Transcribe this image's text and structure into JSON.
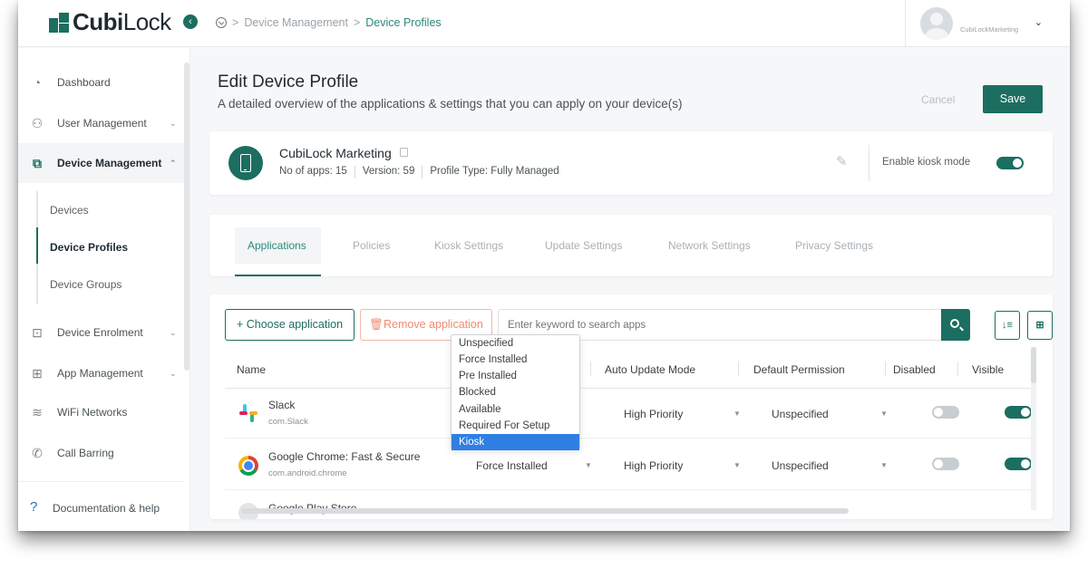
{
  "colors": {
    "brand": "#1b6e60",
    "accent_link": "#2a8a7a",
    "remove": "#f08b72",
    "selected": "#2f7fe3"
  },
  "app": {
    "logo_bold": "Cubi",
    "logo_light": "Lock"
  },
  "breadcrumb": {
    "items": [
      "Device Management",
      "Device Profiles"
    ],
    "separator": ">"
  },
  "user": {
    "name": "CubiLockMarketing"
  },
  "sidebar": {
    "items": [
      {
        "label": "Dashboard",
        "icon": "dashboard-icon"
      },
      {
        "label": "User Management",
        "icon": "users-icon"
      },
      {
        "label": "Device Management",
        "icon": "devices-icon"
      },
      {
        "label": "Device Enrolment",
        "icon": "enrolment-icon"
      },
      {
        "label": "App Management",
        "icon": "apps-icon"
      },
      {
        "label": "WiFi Networks",
        "icon": "wifi-icon"
      },
      {
        "label": "Call Barring",
        "icon": "call-barring-icon"
      }
    ],
    "sub_items": [
      "Devices",
      "Device Profiles",
      "Device Groups"
    ],
    "help": "Documentation & help"
  },
  "page": {
    "title": "Edit Device Profile",
    "subtitle": "A detailed overview of the applications & settings that you can apply on your device(s)",
    "cancel": "Cancel",
    "save": "Save"
  },
  "profile": {
    "name": "CubiLock Marketing",
    "apps": "No of apps: 15",
    "version": "Version: 59",
    "type": "Profile Type: Fully Managed",
    "kiosk_label": "Enable kiosk mode",
    "kiosk_enabled": true
  },
  "tabs": [
    "Applications",
    "Policies",
    "Kiosk Settings",
    "Update Settings",
    "Network Settings",
    "Privacy Settings"
  ],
  "toolbar": {
    "choose": "+ Choose application",
    "remove": "Remove application",
    "search_placeholder": "Enter keyword to search apps"
  },
  "table": {
    "columns": [
      "Name",
      "Auto Update Mode",
      "Default Permission",
      "Disabled",
      "Visible"
    ],
    "rows": [
      {
        "name": "Slack",
        "pkg": "com.Slack",
        "install": "",
        "update": "High Priority",
        "permission": "Unspecified",
        "disabled": false,
        "visible": true
      },
      {
        "name": "Google Chrome: Fast & Secure",
        "pkg": "com.android.chrome",
        "install": "Force Installed",
        "update": "High Priority",
        "permission": "Unspecified",
        "disabled": false,
        "visible": true
      },
      {
        "name": "Google Play Store",
        "pkg": "",
        "install": "",
        "update": "",
        "permission": "",
        "disabled": false,
        "visible": true
      }
    ]
  },
  "dropdown": {
    "options": [
      "Unspecified",
      "Force Installed",
      "Pre Installed",
      "Blocked",
      "Available",
      "Required For Setup",
      "Kiosk"
    ],
    "selected": "Kiosk"
  }
}
